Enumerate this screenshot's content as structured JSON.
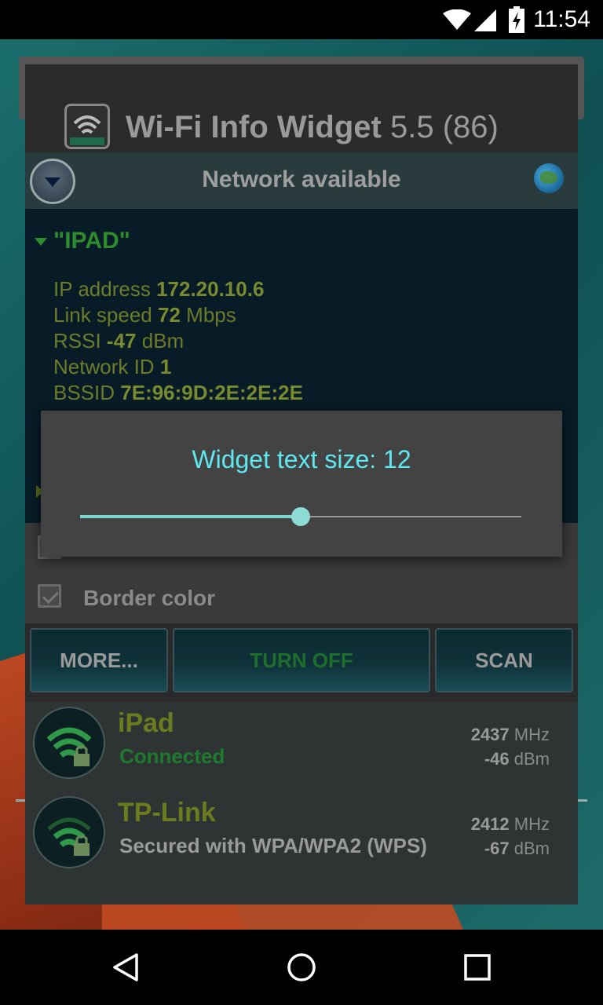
{
  "status_bar": {
    "time": "11:54"
  },
  "app": {
    "title": "Wi-Fi Info Widget",
    "version": "5.5 (86)"
  },
  "network_status": "Network available",
  "connection": {
    "ssid": "\"IPAD\"",
    "ip_label": "IP address",
    "ip_value": "172.20.10.6",
    "speed_label": "Link speed",
    "speed_value": "72",
    "speed_unit": "Mbps",
    "rssi_label": "RSSI",
    "rssi_value": "-47",
    "rssi_unit": "dBm",
    "netid_label": "Network ID",
    "netid_value": "1",
    "bssid_label": "BSSID",
    "bssid_value": "7E:96:9D:2E:2E:2E"
  },
  "options": {
    "border_color_label": "Border color",
    "border_color_checked": true
  },
  "buttons": {
    "more": "MORE...",
    "turn_off": "TURN OFF",
    "scan": "SCAN"
  },
  "networks": [
    {
      "name": "iPad",
      "status": "Connected",
      "status_color": "#1e7a2e",
      "freq": "2437",
      "freq_unit": "MHz",
      "level": "-46",
      "level_unit": "dBm"
    },
    {
      "name": "TP-Link",
      "status": "Secured with WPA/WPA2 (WPS)",
      "status_color": "#9a9a9a",
      "freq": "2412",
      "freq_unit": "MHz",
      "level": "-67",
      "level_unit": "dBm"
    }
  ],
  "dialog": {
    "title": "Widget text size: 12",
    "slider_fraction": 0.5
  },
  "colors": {
    "accent": "#5fe8f0",
    "slider": "#7fd6d0",
    "green": "#2e8b2e"
  }
}
